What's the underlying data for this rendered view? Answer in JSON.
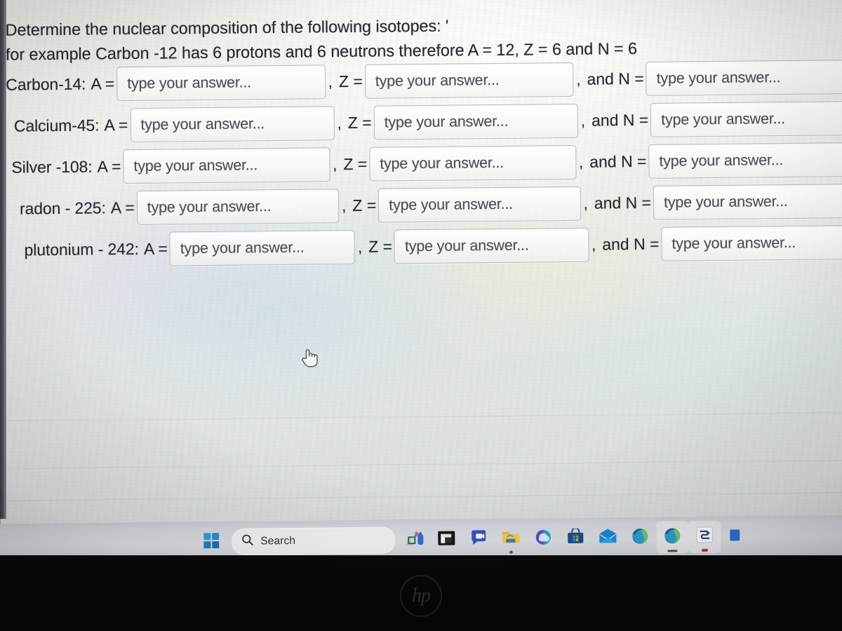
{
  "question": {
    "line1": "Determine the nuclear composition of the following isotopes: '",
    "line2": "for example Carbon -12  has 6 protons and 6 neutrons therefore A = 12, Z = 6 and N = 6"
  },
  "placeholder": "type your answer...",
  "labels": {
    "a_equals": "A =",
    "z_equals": "Z =",
    "n_equals": "and N =",
    "comma": ",",
    "comma_n": ","
  },
  "rows": [
    {
      "isotope": "Carbon-14:",
      "a": "A =",
      "z": "Z =",
      "n": "and N =",
      "a_value": "",
      "z_value": "",
      "n_value": ""
    },
    {
      "isotope": "Calcium-45:",
      "a": "A =",
      "z": "Z =",
      "n": "and N =",
      "a_value": "",
      "z_value": "",
      "n_value": ""
    },
    {
      "isotope": "Silver -108:",
      "a": "A =",
      "z": "Z =",
      "n": "and N =",
      "a_value": "",
      "z_value": "",
      "n_value": ""
    },
    {
      "isotope": "radon - 225:",
      "a": "A =",
      "z": "Z =",
      "n": "and N =",
      "a_value": "",
      "z_value": "",
      "n_value": ""
    },
    {
      "isotope": "plutonium - 242:",
      "a": "A =",
      "z": "Z =",
      "n": "and N =",
      "a_value": "",
      "z_value": "",
      "n_value": ""
    }
  ],
  "cursor": {
    "icon": "pointing-hand-cursor"
  },
  "taskbar": {
    "start": {
      "icon": "windows-start-icon",
      "label": "Start"
    },
    "search": {
      "icon": "search-icon",
      "label": "Search",
      "placeholder": "Search"
    },
    "items": [
      {
        "icon": "widgets-weather-icon",
        "name": "widgets-button",
        "running": false
      },
      {
        "icon": "file-explorer-icon",
        "name": "taskbar-file-explorer",
        "running": false
      },
      {
        "icon": "chat-teams-icon",
        "name": "taskbar-chat",
        "running": false
      },
      {
        "icon": "folder-icon",
        "name": "taskbar-folder",
        "running": true
      },
      {
        "icon": "onedrive-icon",
        "name": "taskbar-onedrive",
        "running": false
      },
      {
        "icon": "microsoft-store-icon",
        "name": "taskbar-microsoft-store",
        "running": false
      },
      {
        "icon": "mail-icon",
        "name": "taskbar-mail",
        "running": false
      },
      {
        "icon": "edge-icon",
        "name": "taskbar-edge",
        "running": false
      },
      {
        "icon": "edge-icon",
        "name": "taskbar-edge-window",
        "running": true
      },
      {
        "icon": "notes-app-icon",
        "name": "taskbar-notes",
        "running": true
      }
    ]
  },
  "device": {
    "brand": "hp"
  },
  "colors": {
    "page_background": "#eceeec",
    "text": "#23272c",
    "placeholder_text": "#4a4e54",
    "field_border": "#b9bbbd",
    "taskbar_background": "#d5d8dd",
    "bezel": "#07070a",
    "windows_blue": "#0078d4"
  }
}
